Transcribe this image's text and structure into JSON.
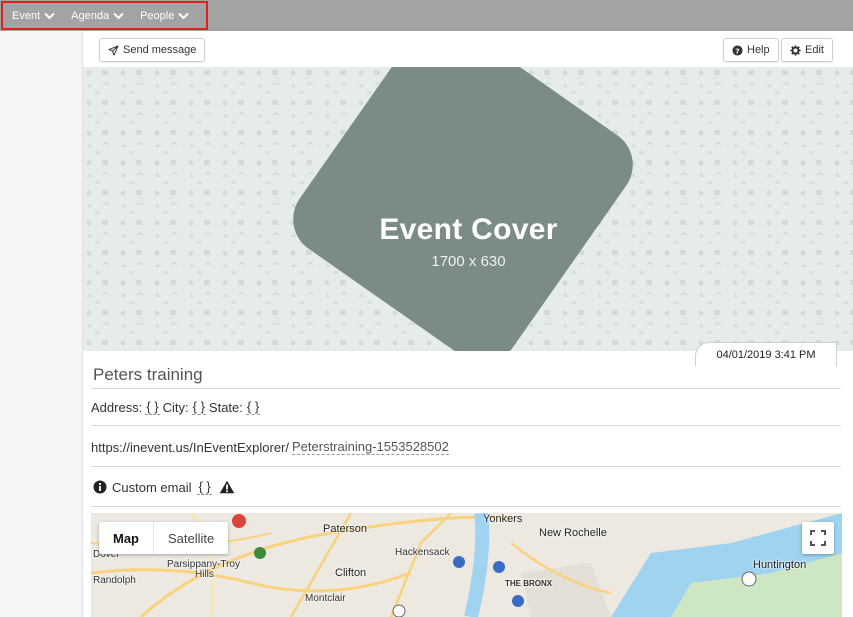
{
  "nav": {
    "items": [
      {
        "label": "Event"
      },
      {
        "label": "Agenda"
      },
      {
        "label": "People"
      }
    ]
  },
  "toolbar": {
    "send_message": "Send message",
    "help": "Help",
    "edit": "Edit"
  },
  "cover": {
    "title": "Event Cover",
    "size": "1700 x 630"
  },
  "event": {
    "datetime": "04/01/2019 3:41 PM",
    "name": "Peters training",
    "address_label": "Address:",
    "address_value": "{ }",
    "city_label": "City:",
    "city_value": "{ }",
    "state_label": "State:",
    "state_value": "{ }",
    "url_prefix": "https://inevent.us/InEventExplorer/",
    "url_slug": "Peterstraining-1553528502",
    "custom_email_label": "Custom email",
    "custom_email_value": "{ }"
  },
  "map": {
    "tab_map": "Map",
    "tab_satellite": "Satellite",
    "labels": {
      "paterson": "Paterson",
      "yonkers": "Yonkers",
      "new_rochelle": "New Rochelle",
      "hackensack": "Hackensack",
      "parsippany": "Parsippany-Troy",
      "hills": "Hills",
      "clifton": "Clifton",
      "randolph": "Randolph",
      "dover": "Dover",
      "montclair": "Montclair",
      "bronx": "THE BRONX",
      "huntington": "Huntington"
    }
  },
  "colors": {
    "topbar": "#a3a3a3",
    "highlight": "#e0201d",
    "cover_bg": "#e6ebeb",
    "cover_shape": "#7a8b88"
  }
}
